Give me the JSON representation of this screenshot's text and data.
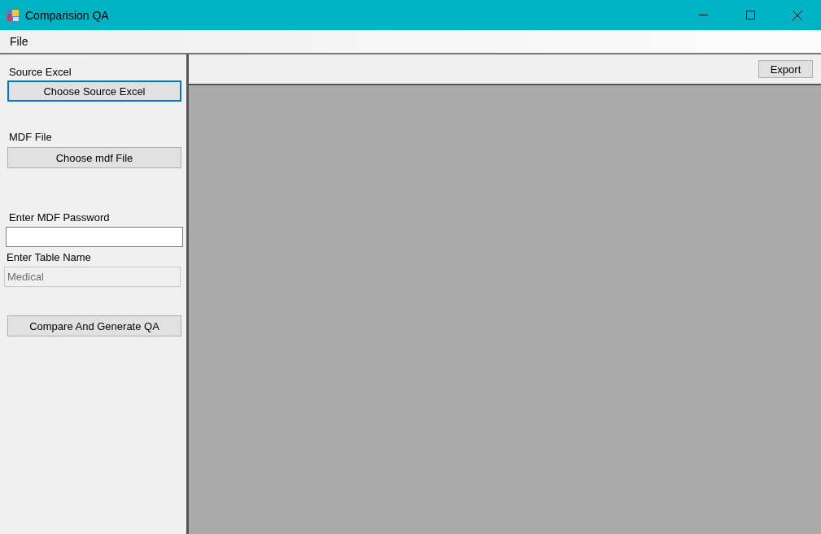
{
  "window": {
    "title": "Comparision QA"
  },
  "menu": [
    {
      "label": "File"
    }
  ],
  "source": {
    "label": "Source Excel",
    "button": "Choose Source Excel",
    "focused": true
  },
  "mdf": {
    "label": "MDF File",
    "button": "Choose mdf File",
    "focused": false
  },
  "password": {
    "label": "Enter MDF Password",
    "disabled": false
  },
  "table_name": {
    "label": "Enter Table Name",
    "value": "Medical",
    "disabled": true
  },
  "compare_button": "Compare And Generate QA",
  "export_button": "Export"
}
